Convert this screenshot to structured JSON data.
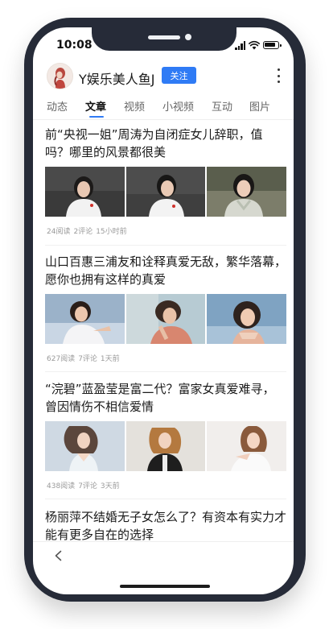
{
  "status": {
    "time": "10:08"
  },
  "profile": {
    "name": "Y娱乐美人鱼J",
    "follow_label": "关注"
  },
  "tabs": [
    {
      "label": "动态",
      "active": false
    },
    {
      "label": "文章",
      "active": true
    },
    {
      "label": "视频",
      "active": false
    },
    {
      "label": "小视频",
      "active": false
    },
    {
      "label": "互动",
      "active": false
    },
    {
      "label": "图片",
      "active": false
    }
  ],
  "articles": [
    {
      "title": "前“央视一姐”周涛为自闭症女儿辞职，值吗？哪里的风景都很美",
      "reads": "24阅读",
      "comments": "2评论",
      "time": "15小时前"
    },
    {
      "title": "山口百惠三浦友和诠释真爱无敌，繁华落幕，愿你也拥有这样的真爱",
      "reads": "627阅读",
      "comments": "7评论",
      "time": "1天前"
    },
    {
      "title": "“浣碧”蓝盈莹是富二代？富家女真爱难寻，曾因情伤不相信爱情",
      "reads": "438阅读",
      "comments": "7评论",
      "time": "3天前"
    },
    {
      "title": "杨丽萍不结婚无子女怎么了？有资本有实力才能有更多自在的选择"
    }
  ],
  "colors": {
    "accent": "#2f7bf5",
    "phone_frame": "#262b38",
    "meta_text": "#9a9a9a"
  }
}
